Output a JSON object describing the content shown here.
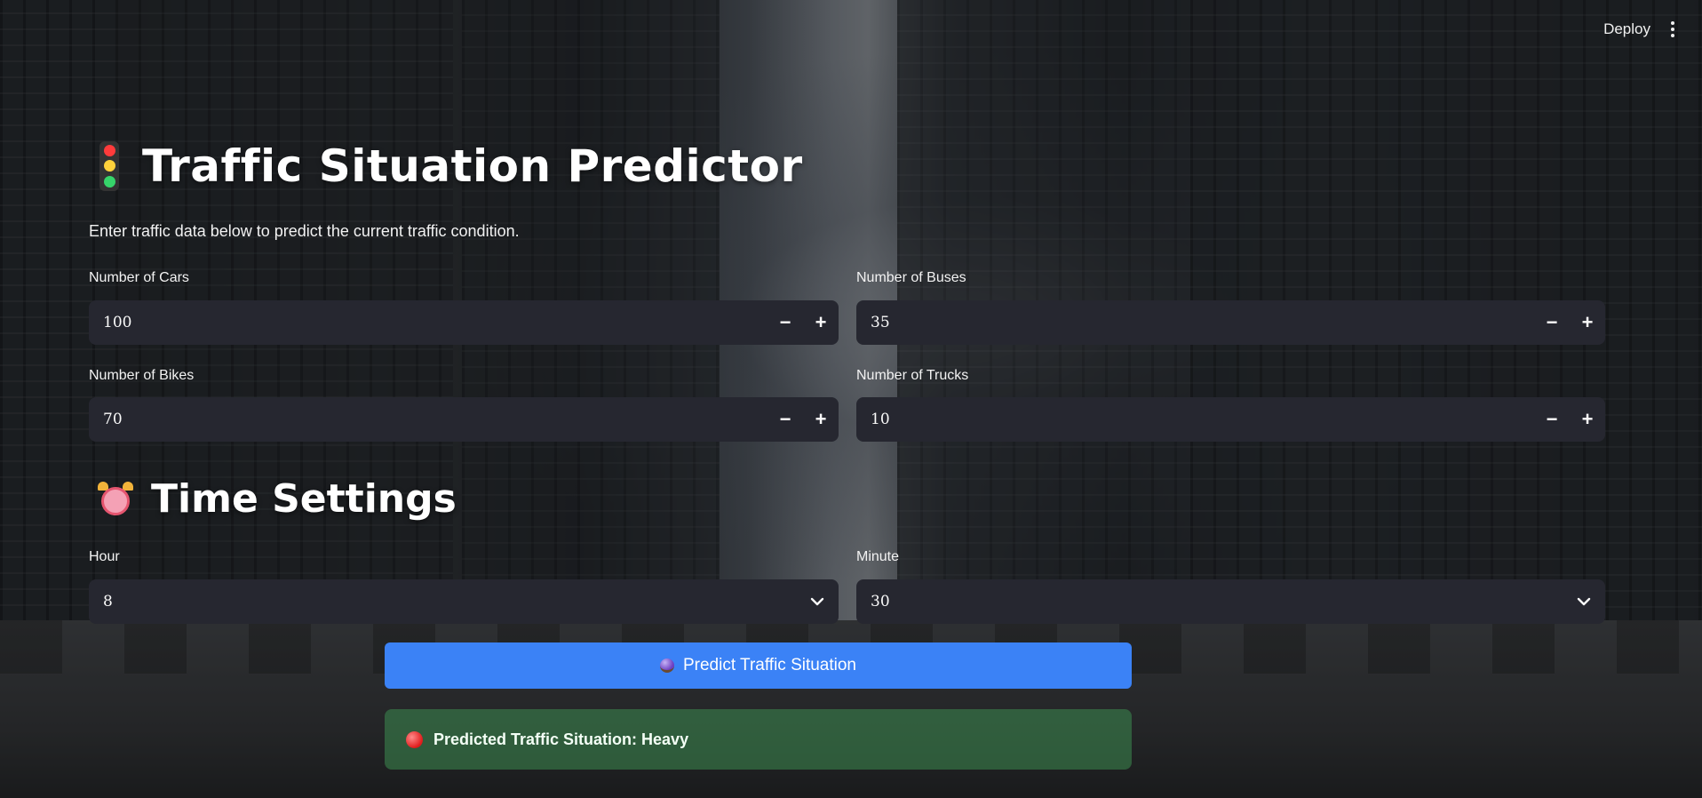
{
  "header": {
    "deploy_label": "Deploy"
  },
  "page": {
    "title": "Traffic Situation Predictor",
    "subtitle": "Enter traffic data below to predict the current traffic condition."
  },
  "inputs": {
    "cars": {
      "label": "Number of Cars",
      "value": "100"
    },
    "buses": {
      "label": "Number of Buses",
      "value": "35"
    },
    "bikes": {
      "label": "Number of Bikes",
      "value": "70"
    },
    "trucks": {
      "label": "Number of Trucks",
      "value": "10"
    }
  },
  "stepper": {
    "minus": "−",
    "plus": "+"
  },
  "time_settings": {
    "heading": "Time Settings",
    "hour": {
      "label": "Hour",
      "value": "8"
    },
    "minute": {
      "label": "Minute",
      "value": "30"
    }
  },
  "predict_button": {
    "label": "Predict Traffic Situation"
  },
  "result": {
    "text": "Predicted Traffic Situation: Heavy"
  },
  "colors": {
    "primary_button": "#3b82f6",
    "input_bg": "#262730",
    "success_bg": "#3c8c50"
  },
  "icons": [
    "traffic-light-icon",
    "alarm-clock-icon",
    "crystal-ball-icon",
    "red-circle-icon",
    "chevron-down-icon",
    "kebab-menu-icon"
  ]
}
